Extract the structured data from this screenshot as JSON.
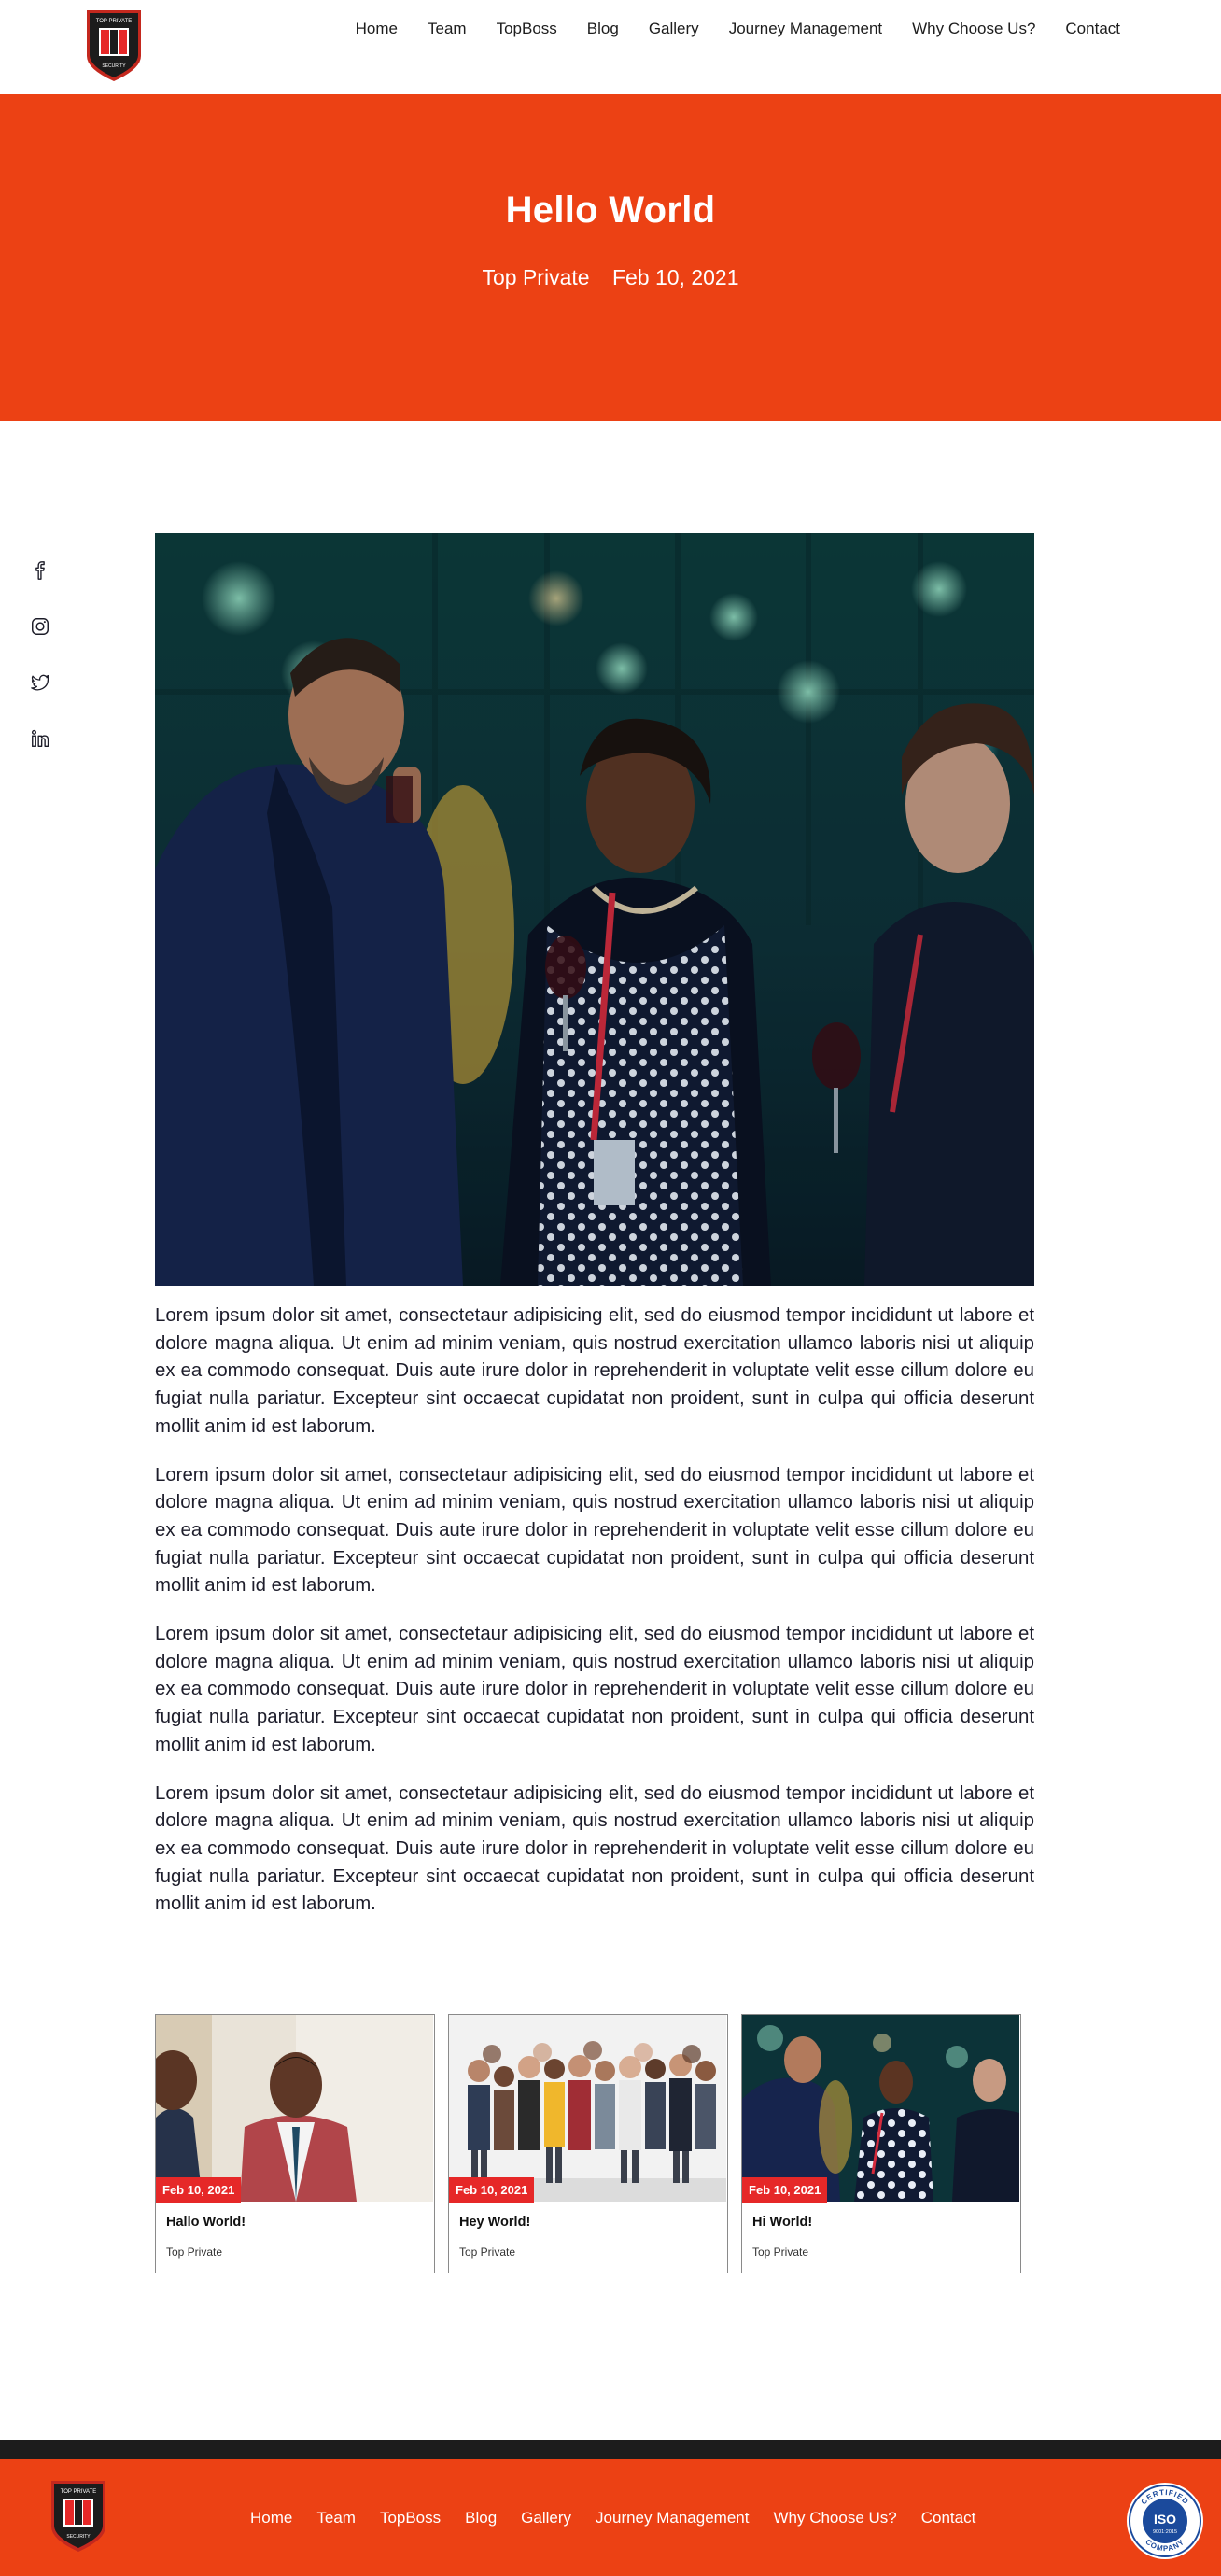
{
  "brand": {
    "logo_text_top": "TOP PRIVATE",
    "logo_text_bottom": "SECURITY",
    "accent": "#ec4114",
    "dark": "#1c1c1c"
  },
  "nav": {
    "items": [
      "Home",
      "Team",
      "TopBoss",
      "Blog",
      "Gallery",
      "Journey Management",
      "Why Choose Us?",
      "Contact"
    ]
  },
  "hero": {
    "title": "Hello World",
    "author": "Top Private",
    "date": "Feb 10, 2021"
  },
  "social": {
    "icons": [
      "facebook-icon",
      "instagram-icon",
      "twitter-icon",
      "linkedin-icon"
    ]
  },
  "article": {
    "image_subject": "business people toasting with wine glasses",
    "paragraphs": [
      "Lorem ipsum dolor sit amet, consectetaur adipisicing elit, sed do eiusmod tempor incididunt ut labore et dolore magna aliqua. Ut enim ad minim veniam, quis nostrud exercitation ullamco laboris nisi ut aliquip ex ea commodo consequat. Duis aute irure dolor in reprehenderit in voluptate velit esse cillum dolore eu fugiat nulla pariatur. Excepteur sint occaecat cupidatat non proident, sunt in culpa qui officia deserunt mollit anim id est laborum.",
      "Lorem ipsum dolor sit amet, consectetaur adipisicing elit, sed do eiusmod tempor incididunt ut labore et dolore magna aliqua. Ut enim ad minim veniam, quis nostrud exercitation ullamco laboris nisi ut aliquip ex ea commodo consequat. Duis aute irure dolor in reprehenderit in voluptate velit esse cillum dolore eu fugiat nulla pariatur. Excepteur sint occaecat cupidatat non proident, sunt in culpa qui officia deserunt mollit anim id est laborum.",
      "Lorem ipsum dolor sit amet, consectetaur adipisicing elit, sed do eiusmod tempor incididunt ut labore et dolore magna aliqua. Ut enim ad minim veniam, quis nostrud exercitation ullamco laboris nisi ut aliquip ex ea commodo consequat. Duis aute irure dolor in reprehenderit in voluptate velit esse cillum dolore eu fugiat nulla pariatur. Excepteur sint occaecat cupidatat non proident, sunt in culpa qui officia deserunt mollit anim id est laborum.",
      "Lorem ipsum dolor sit amet, consectetaur adipisicing elit, sed do eiusmod tempor incididunt ut labore et dolore magna aliqua. Ut enim ad minim veniam, quis nostrud exercitation ullamco laboris nisi ut aliquip ex ea commodo consequat. Duis aute irure dolor in reprehenderit in voluptate velit esse cillum dolore eu fugiat nulla pariatur. Excepteur sint occaecat cupidatat non proident, sunt in culpa qui officia deserunt mollit anim id est laborum."
    ]
  },
  "related": [
    {
      "date": "Feb 10, 2021",
      "title": "Hallo World!",
      "author": "Top Private"
    },
    {
      "date": "Feb 10, 2021",
      "title": "Hey World!",
      "author": "Top Private"
    },
    {
      "date": "Feb 10, 2021",
      "title": "Hi World!",
      "author": "Top Private"
    }
  ],
  "footer": {
    "nav": [
      "Home",
      "Team",
      "TopBoss",
      "Blog",
      "Gallery",
      "Journey Management",
      "Why Choose Us?",
      "Contact"
    ],
    "iso": {
      "top": "CERTIFIED",
      "center": "ISO",
      "code": "9001:2015",
      "bottom": "COMPANY"
    }
  }
}
